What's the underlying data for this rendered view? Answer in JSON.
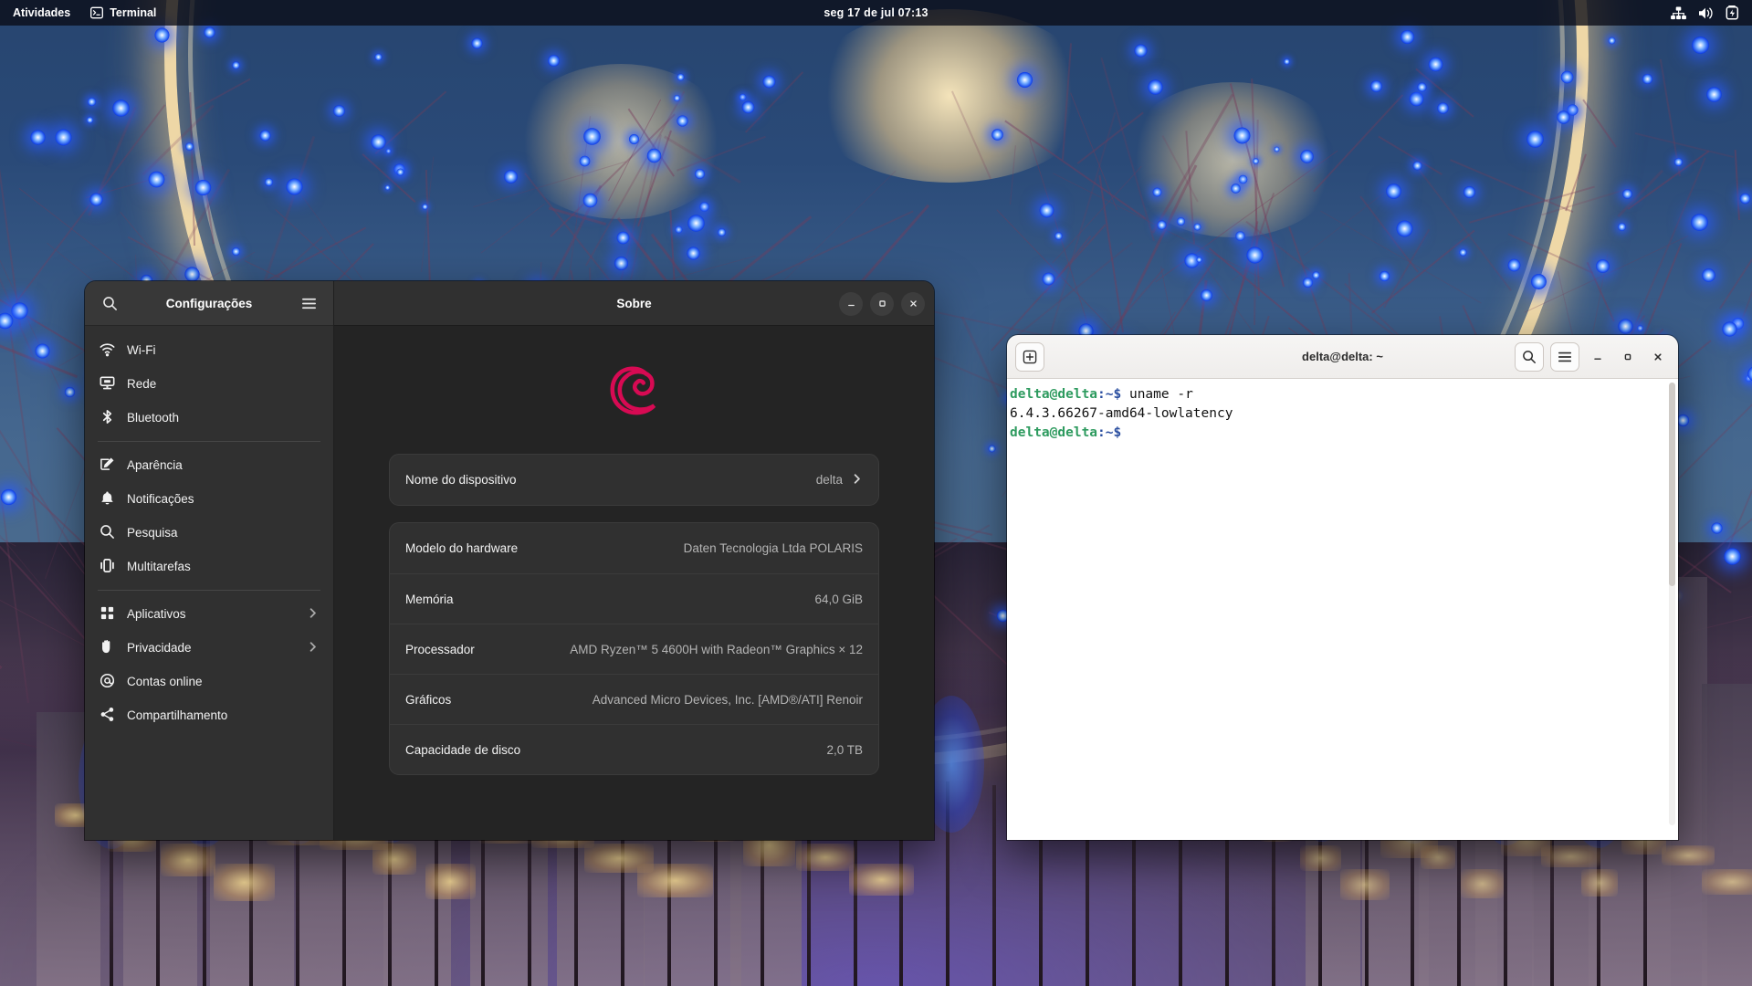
{
  "topbar": {
    "activities": "Atividades",
    "app_name": "Terminal",
    "app_icon": "terminal-icon",
    "clock": "seg 17 de jul  07:13",
    "indicators": [
      {
        "name": "network-wired-icon"
      },
      {
        "name": "volume-icon"
      },
      {
        "name": "battery-icon"
      }
    ]
  },
  "settings": {
    "sidebar": {
      "search_icon": "search-icon",
      "title": "Configurações",
      "menu_icon": "hamburger-menu-icon",
      "groups": [
        {
          "items": [
            {
              "label": "Wi-Fi",
              "icon": "wifi-icon",
              "chevron": false
            },
            {
              "label": "Rede",
              "icon": "network-icon",
              "chevron": false
            },
            {
              "label": "Bluetooth",
              "icon": "bluetooth-icon",
              "chevron": false
            }
          ]
        },
        {
          "items": [
            {
              "label": "Aparência",
              "icon": "appearance-icon",
              "chevron": false
            },
            {
              "label": "Notificações",
              "icon": "bell-icon",
              "chevron": false
            },
            {
              "label": "Pesquisa",
              "icon": "search-icon",
              "chevron": false
            },
            {
              "label": "Multitarefas",
              "icon": "multitasking-icon",
              "chevron": false
            }
          ]
        },
        {
          "items": [
            {
              "label": "Aplicativos",
              "icon": "apps-grid-icon",
              "chevron": true
            },
            {
              "label": "Privacidade",
              "icon": "hand-privacy-icon",
              "chevron": true
            },
            {
              "label": "Contas online",
              "icon": "at-sign-icon",
              "chevron": false
            },
            {
              "label": "Compartilhamento",
              "icon": "share-icon",
              "chevron": false
            }
          ]
        }
      ]
    },
    "window": {
      "title": "Sobre",
      "minimize": "—",
      "maximize": "□",
      "close": "✕",
      "logo": "debian-swirl-logo",
      "logo_color": "#d70a53"
    },
    "about_cards": [
      {
        "rows": [
          {
            "key": "Nome do dispositivo",
            "value": "delta",
            "chevron": true
          }
        ]
      },
      {
        "rows": [
          {
            "key": "Modelo do hardware",
            "value": "Daten Tecnologia Ltda POLARIS",
            "chevron": false
          },
          {
            "key": "Memória",
            "value": "64,0 GiB",
            "chevron": false
          },
          {
            "key": "Processador",
            "value": "AMD Ryzen™ 5 4600H with Radeon™ Graphics × 12",
            "chevron": false
          },
          {
            "key": "Gráficos",
            "value": "Advanced Micro Devices, Inc. [AMD®/ATI] Renoir",
            "chevron": false
          },
          {
            "key": "Capacidade de disco",
            "value": "2,0 TB",
            "chevron": false
          }
        ]
      }
    ]
  },
  "terminal": {
    "new_tab_icon": "new-tab-icon",
    "title": "delta@delta: ~",
    "search_icon": "search-icon",
    "menu_icon": "hamburger-menu-icon",
    "minimize": "—",
    "maximize": "□",
    "close": "✕",
    "prompt_user": "delta@delta",
    "prompt_path": ":~$",
    "lines": [
      {
        "type": "prompt",
        "command": " uname -r"
      },
      {
        "type": "output",
        "text": "6.4.3.66267-amd64-lowlatency"
      },
      {
        "type": "prompt",
        "command": ""
      }
    ]
  }
}
